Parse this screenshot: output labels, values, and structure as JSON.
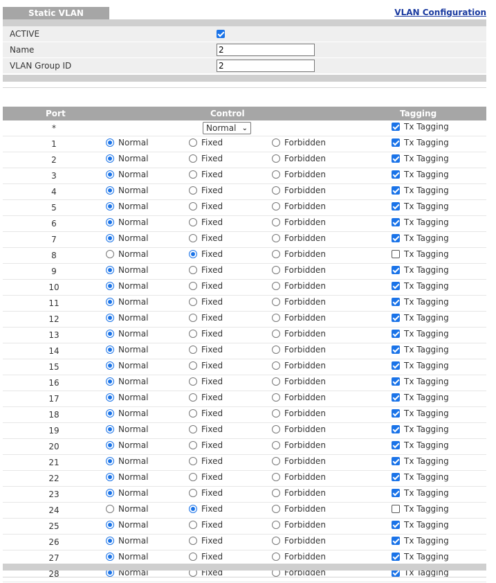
{
  "header": {
    "tab_label": "Static VLAN",
    "config_link": "VLAN Configuration"
  },
  "form": {
    "active_label": "ACTIVE",
    "active_checked": true,
    "name_label": "Name",
    "name_value": "2",
    "group_id_label": "VLAN Group ID",
    "group_id_value": "2"
  },
  "table": {
    "col_port": "Port",
    "col_control": "Control",
    "col_tagging": "Tagging",
    "all_row": {
      "port": "*",
      "control_select": "Normal",
      "tagging_checked": true,
      "tagging_label": "Tx Tagging"
    },
    "option_labels": {
      "normal": "Normal",
      "fixed": "Fixed",
      "forbidden": "Forbidden",
      "tagging": "Tx Tagging"
    },
    "rows": [
      {
        "port": "1",
        "control": "normal",
        "tagging": true
      },
      {
        "port": "2",
        "control": "normal",
        "tagging": true
      },
      {
        "port": "3",
        "control": "normal",
        "tagging": true
      },
      {
        "port": "4",
        "control": "normal",
        "tagging": true
      },
      {
        "port": "5",
        "control": "normal",
        "tagging": true
      },
      {
        "port": "6",
        "control": "normal",
        "tagging": true
      },
      {
        "port": "7",
        "control": "normal",
        "tagging": true
      },
      {
        "port": "8",
        "control": "fixed",
        "tagging": false
      },
      {
        "port": "9",
        "control": "normal",
        "tagging": true
      },
      {
        "port": "10",
        "control": "normal",
        "tagging": true
      },
      {
        "port": "11",
        "control": "normal",
        "tagging": true
      },
      {
        "port": "12",
        "control": "normal",
        "tagging": true
      },
      {
        "port": "13",
        "control": "normal",
        "tagging": true
      },
      {
        "port": "14",
        "control": "normal",
        "tagging": true
      },
      {
        "port": "15",
        "control": "normal",
        "tagging": true
      },
      {
        "port": "16",
        "control": "normal",
        "tagging": true
      },
      {
        "port": "17",
        "control": "normal",
        "tagging": true
      },
      {
        "port": "18",
        "control": "normal",
        "tagging": true
      },
      {
        "port": "19",
        "control": "normal",
        "tagging": true
      },
      {
        "port": "20",
        "control": "normal",
        "tagging": true
      },
      {
        "port": "21",
        "control": "normal",
        "tagging": true
      },
      {
        "port": "22",
        "control": "normal",
        "tagging": true
      },
      {
        "port": "23",
        "control": "normal",
        "tagging": true
      },
      {
        "port": "24",
        "control": "fixed",
        "tagging": false
      },
      {
        "port": "25",
        "control": "normal",
        "tagging": true
      },
      {
        "port": "26",
        "control": "normal",
        "tagging": true
      },
      {
        "port": "27",
        "control": "normal",
        "tagging": true
      },
      {
        "port": "28",
        "control": "normal",
        "tagging": true
      }
    ]
  },
  "colors": {
    "accent": "#1a73e8",
    "header_bg": "#a6a6a6",
    "row_bg": "#efefef",
    "link": "#1a3aa0"
  }
}
